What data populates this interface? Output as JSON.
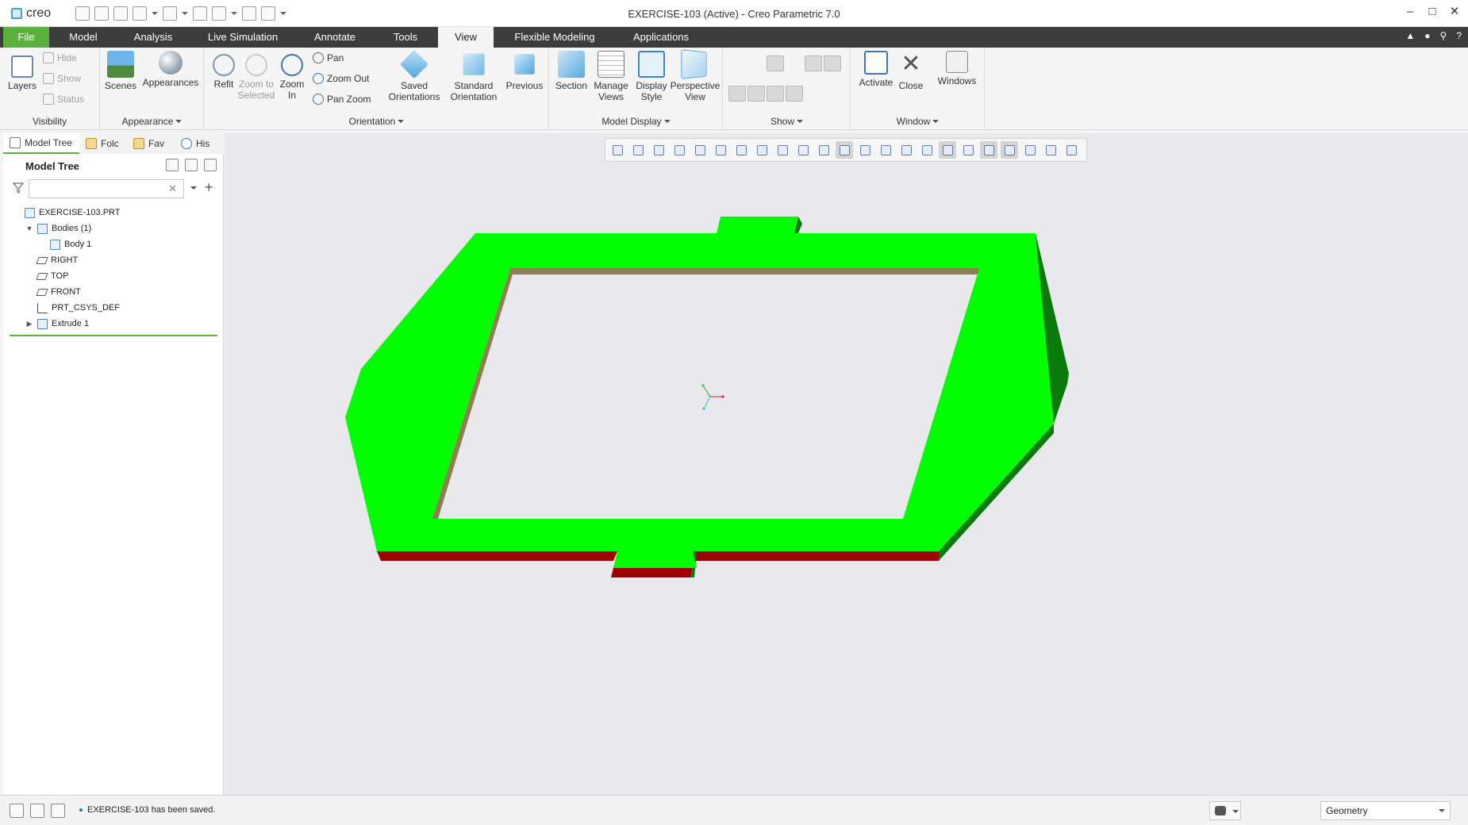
{
  "app": {
    "title": "EXERCISE-103 (Active) - Creo Parametric 7.0",
    "logo_text": "creo",
    "accent_color": "#5bb13c"
  },
  "ribbon_tabs": [
    "File",
    "Model",
    "Analysis",
    "Live Simulation",
    "Annotate",
    "Tools",
    "View",
    "Flexible Modeling",
    "Applications"
  ],
  "active_tab": "View",
  "ribbon": {
    "visibility": {
      "label": "Visibility",
      "layers": "Layers",
      "hide": "Hide",
      "show": "Show",
      "status": "Status"
    },
    "appearance": {
      "label": "Appearance",
      "scenes": "Scenes",
      "appearances": "Appearances"
    },
    "orientation": {
      "label": "Orientation",
      "refit": "Refit",
      "zoom_to_selected_1": "Zoom to",
      "zoom_to_selected_2": "Selected",
      "zoom_in_1": "Zoom",
      "zoom_in_2": "In",
      "pan": "Pan",
      "zoom_out": "Zoom Out",
      "pan_zoom": "Pan Zoom",
      "saved_orientations_1": "Saved",
      "saved_orientations_2": "Orientations",
      "standard_orientation_1": "Standard",
      "standard_orientation_2": "Orientation",
      "previous": "Previous"
    },
    "model_display": {
      "label": "Model Display",
      "section": "Section",
      "manage_views_1": "Manage",
      "manage_views_2": "Views",
      "display_style_1": "Display",
      "display_style_2": "Style",
      "perspective_view_1": "Perspective",
      "perspective_view_2": "View"
    },
    "show": {
      "label": "Show"
    },
    "window": {
      "label": "Window",
      "activate": "Activate",
      "close": "Close",
      "windows": "Windows"
    }
  },
  "nav_tabs": [
    "Model Tree",
    "Folc",
    "Fav",
    "His"
  ],
  "model_tree": {
    "header": "Model Tree",
    "filter_placeholder": "",
    "items": [
      {
        "label": "EXERCISE-103.PRT",
        "icon": "part-icon",
        "indent": 0,
        "expander": ""
      },
      {
        "label": "Bodies (1)",
        "icon": "bodies-icon",
        "indent": 1,
        "expander": "▼"
      },
      {
        "label": "Body 1",
        "icon": "body-icon",
        "indent": 2,
        "expander": ""
      },
      {
        "label": "RIGHT",
        "icon": "datum-plane-icon",
        "indent": 1,
        "expander": ""
      },
      {
        "label": "TOP",
        "icon": "datum-plane-icon",
        "indent": 1,
        "expander": ""
      },
      {
        "label": "FRONT",
        "icon": "datum-plane-icon",
        "indent": 1,
        "expander": ""
      },
      {
        "label": "PRT_CSYS_DEF",
        "icon": "csys-icon",
        "indent": 1,
        "expander": ""
      },
      {
        "label": "Extrude 1",
        "icon": "extrude-icon",
        "indent": 1,
        "expander": "▶"
      }
    ]
  },
  "status_bar": {
    "message": "EXERCISE-103 has been saved.",
    "selection_filter": "Geometry"
  },
  "model_colors": {
    "top_face": "#00ff00",
    "side_face": "#0a7a0a",
    "front_face": "#a00000",
    "inner_wall": "#8c7f50"
  }
}
